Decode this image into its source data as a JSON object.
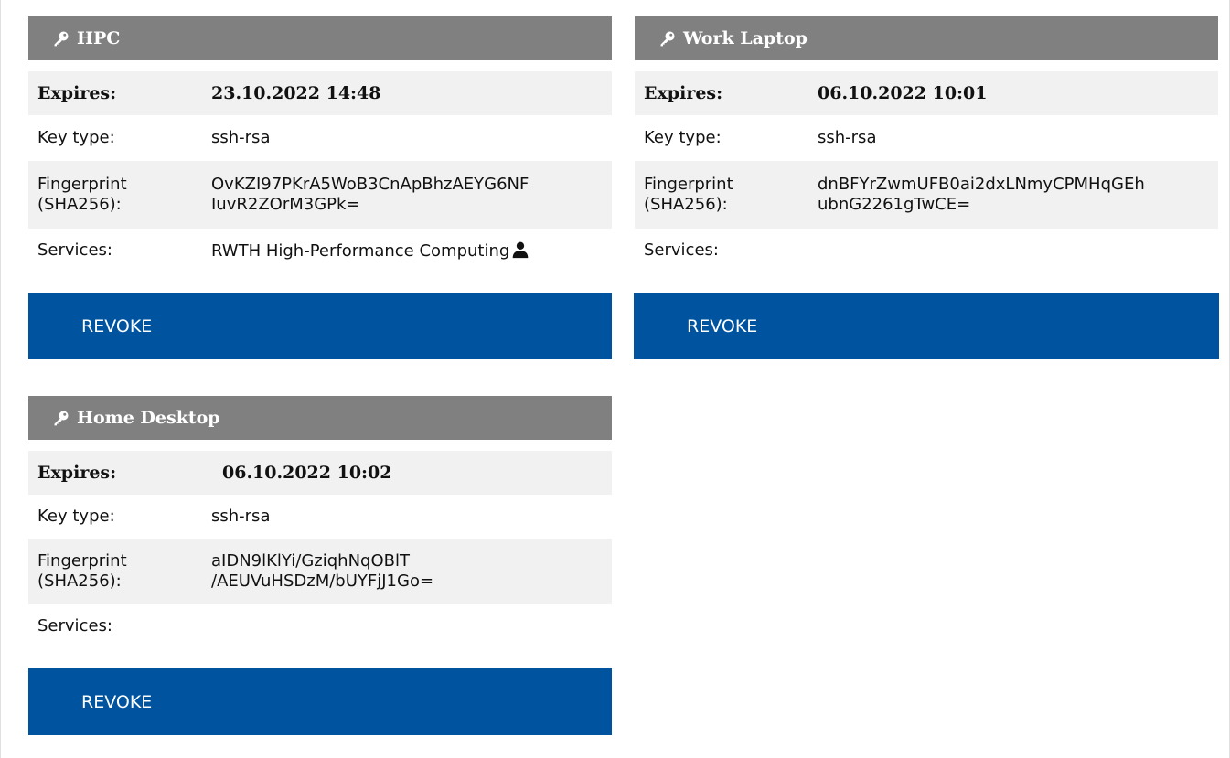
{
  "keys": [
    {
      "name": "HPC",
      "expires_label": "Expires:",
      "expires": "23.10.2022 14:48",
      "key_type_label": "Key type:",
      "key_type": "ssh-rsa",
      "fingerprint_label_1": "Fingerprint",
      "fingerprint_label_2": "(SHA256):",
      "fingerprint_1": "OvKZI97PKrA5WoB3CnApBhzAEYG6NF",
      "fingerprint_2": "IuvR2ZOrM3GPk=",
      "services_label": "Services:",
      "services": "RWTH High-Performance Computing",
      "revoke_label": "REVOKE"
    },
    {
      "name": "Work Laptop",
      "expires_label": "Expires:",
      "expires": "06.10.2022 10:01",
      "key_type_label": "Key type:",
      "key_type": "ssh-rsa",
      "fingerprint_label_1": "Fingerprint",
      "fingerprint_label_2": "(SHA256):",
      "fingerprint_1": "dnBFYrZwmUFB0ai2dxLNmyCPMHqGEh",
      "fingerprint_2": "ubnG2261gTwCE=",
      "services_label": "Services:",
      "services": "",
      "revoke_label": "REVOKE"
    },
    {
      "name": "Home Desktop",
      "expires_label": "Expires:",
      "expires": "06.10.2022 10:02",
      "key_type_label": "Key type:",
      "key_type": "ssh-rsa",
      "fingerprint_label_1": "Fingerprint",
      "fingerprint_label_2": "(SHA256):",
      "fingerprint_1": "aIDN9lKlYi/GziqhNqOBlT",
      "fingerprint_2": "/AEUVuHSDzM/bUYFjJ1Go=",
      "services_label": "Services:",
      "services": "",
      "revoke_label": "REVOKE"
    }
  ],
  "icons": {
    "header_icon": "key-icon",
    "service_icon": "user-icon"
  },
  "colors": {
    "header_bg": "#808080",
    "revoke_bg": "#00549f",
    "row_shade": "#f1f1f1"
  }
}
